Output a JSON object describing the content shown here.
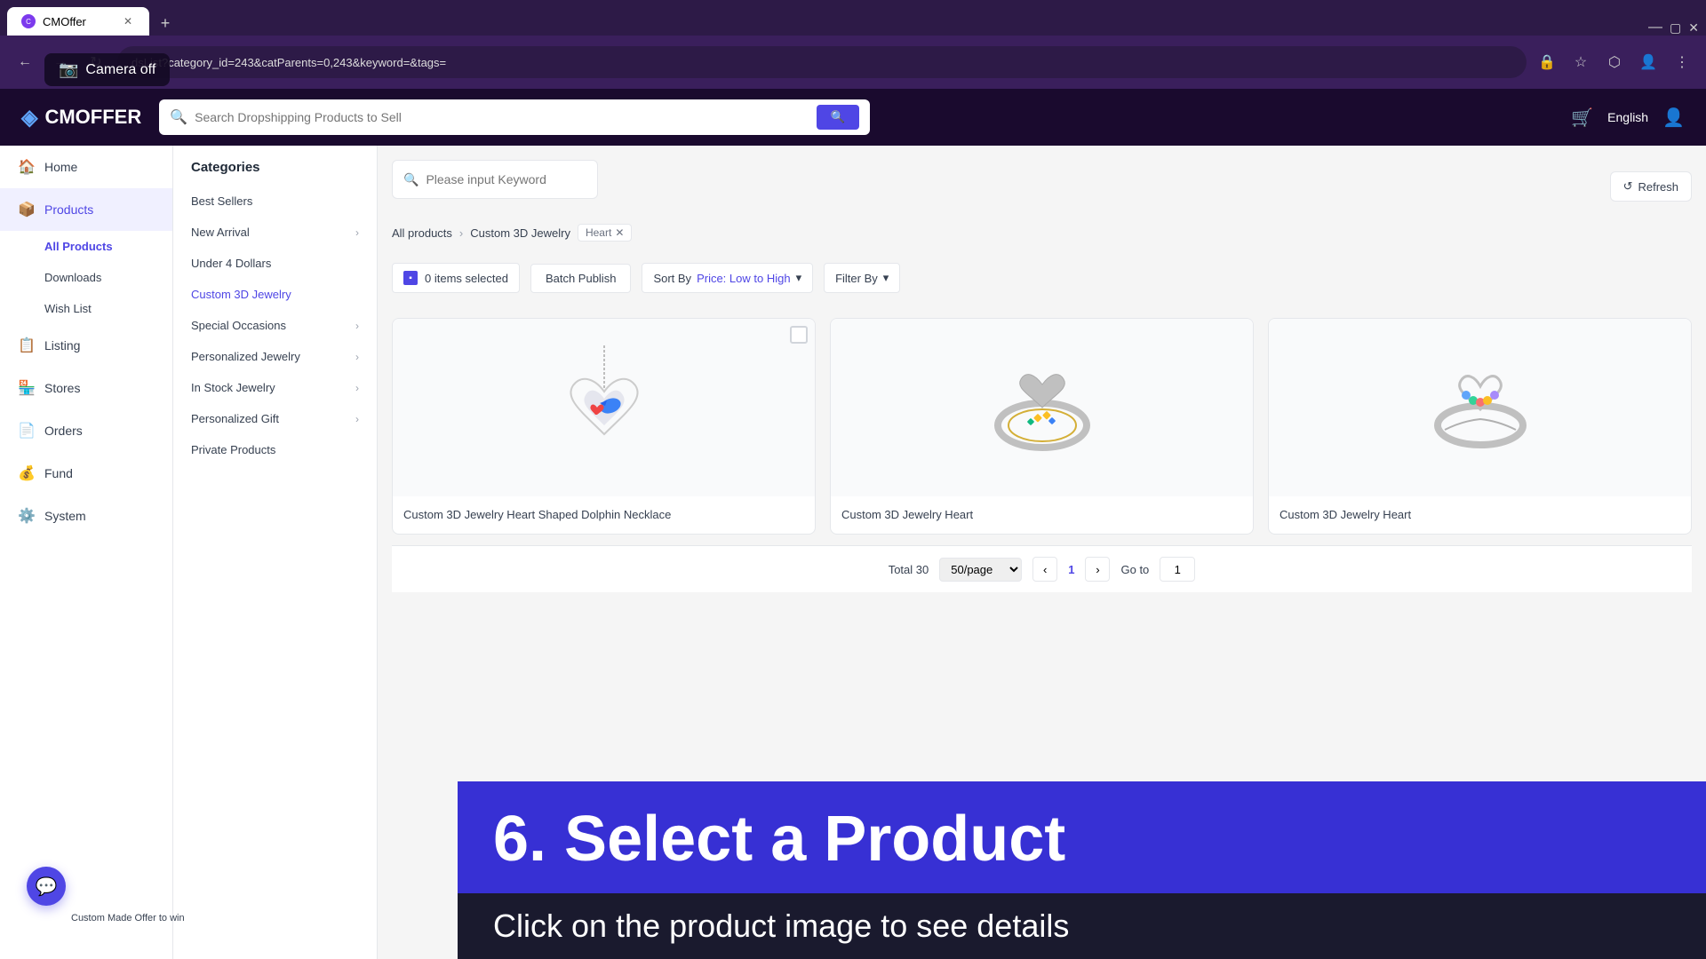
{
  "browser": {
    "tab_label": "CMOffer",
    "address": "dsList?category_id=243&catParents=0,243&keyword=&tags=",
    "new_tab_label": "+"
  },
  "camera_overlay": {
    "label": "Camera off"
  },
  "header": {
    "logo_text": "CMOFFER",
    "search_placeholder": "Search Dropshipping Products to Sell",
    "language": "English"
  },
  "sidebar": {
    "items": [
      {
        "label": "Home",
        "icon": "🏠",
        "active": false
      },
      {
        "label": "Products",
        "icon": "📦",
        "active": true
      },
      {
        "label": "Listing",
        "icon": "📋",
        "active": false
      },
      {
        "label": "Stores",
        "icon": "🏪",
        "active": false
      },
      {
        "label": "Orders",
        "icon": "📄",
        "active": false
      },
      {
        "label": "Fund",
        "icon": "💰",
        "active": false
      },
      {
        "label": "System",
        "icon": "⚙️",
        "active": false
      }
    ],
    "sub_items": [
      {
        "label": "All Products",
        "active": true
      },
      {
        "label": "Downloads",
        "active": false
      },
      {
        "label": "Wish List",
        "active": false
      }
    ]
  },
  "keyword_bar": {
    "placeholder": "Please input Keyword"
  },
  "refresh_btn": "Refresh",
  "breadcrumb": {
    "all_products": "All products",
    "category": "Custom 3D Jewelry",
    "tag": "Heart"
  },
  "toolbar": {
    "items_selected": "0 items selected",
    "batch_publish": "Batch Publish",
    "sort_by_label": "Sort By",
    "sort_by_value": "Price: Low to High",
    "filter_by": "Filter By"
  },
  "categories": {
    "title": "Categories",
    "items": [
      {
        "label": "Best Sellers",
        "has_arrow": false
      },
      {
        "label": "New Arrival",
        "has_arrow": true
      },
      {
        "label": "Under 4 Dollars",
        "has_arrow": false
      },
      {
        "label": "Custom 3D Jewelry",
        "has_arrow": false,
        "active": true
      },
      {
        "label": "Special Occasions",
        "has_arrow": true
      },
      {
        "label": "Personalized Jewelry",
        "has_arrow": true
      },
      {
        "label": "In Stock Jewelry",
        "has_arrow": true
      },
      {
        "label": "Personalized Gift",
        "has_arrow": true
      },
      {
        "label": "Private Products",
        "has_arrow": false
      }
    ]
  },
  "products": [
    {
      "name": "Custom 3D Jewelry Heart Shaped Dolphin Necklace",
      "selected": false
    },
    {
      "name": "Custom 3D Jewelry Heart",
      "selected": false
    },
    {
      "name": "Custom 3D Jewelry Heart",
      "selected": false
    }
  ],
  "pagination": {
    "total_label": "Total 30",
    "per_page": "50/page",
    "current_page": "1",
    "goto_label": "Go to",
    "goto_page": "1"
  },
  "overlay": {
    "step": "6. Select a Product",
    "subtitle": "Click on the product image to see details"
  },
  "chat": {
    "custom_offer_label": "Custom Made Offer to win"
  }
}
